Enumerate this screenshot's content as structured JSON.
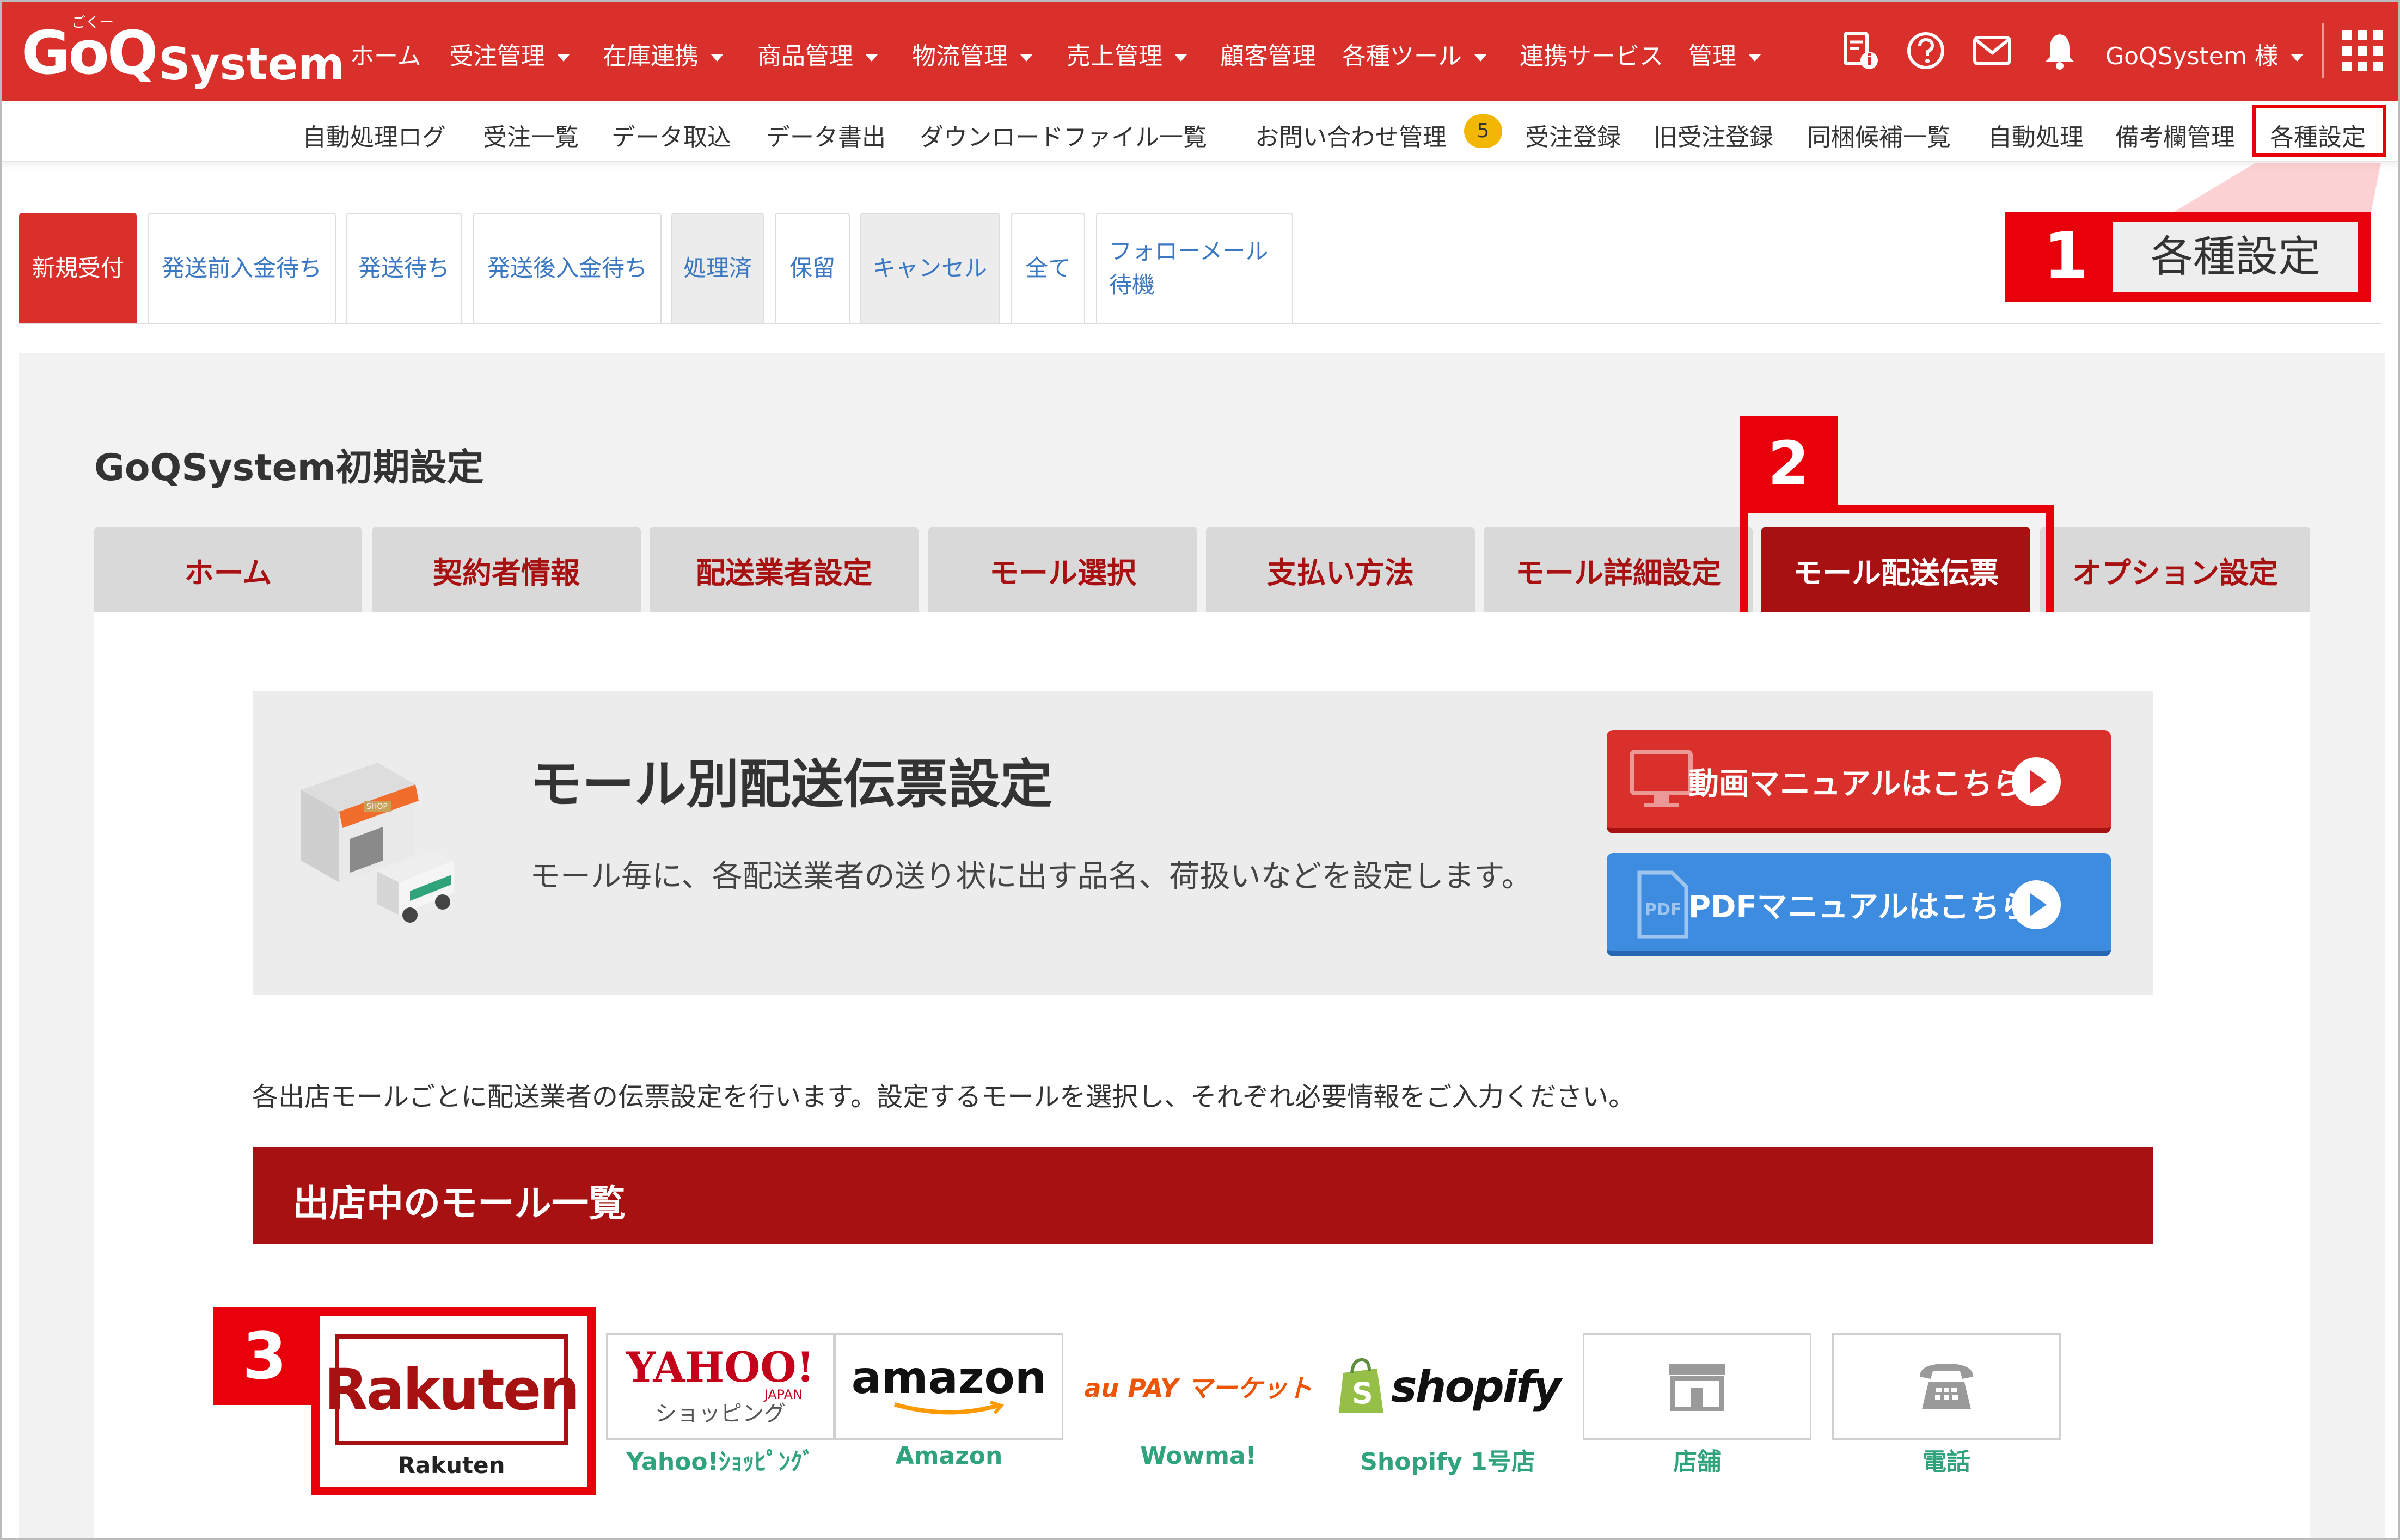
{
  "app": {
    "logo_go": "GoQ",
    "logo_system": "System",
    "logo_kana": "ごくー"
  },
  "topnav": {
    "items": [
      "ホーム",
      "受注管理",
      "在庫連携",
      "商品管理",
      "物流管理",
      "売上管理",
      "顧客管理",
      "各種ツール",
      "連携サービス",
      "管理"
    ],
    "user": "GoQSystem 様"
  },
  "subnav": {
    "items": [
      "自動処理ログ",
      "受注一覧",
      "データ取込",
      "データ書出",
      "ダウンロードファイル一覧",
      "お問い合わせ管理",
      "受注登録",
      "旧受注登録",
      "同梱候補一覧",
      "自動処理",
      "備考欄管理",
      "各種設定"
    ],
    "inquiry_badge": "5"
  },
  "status_tabs": [
    "新規受付",
    "発送前入金待ち",
    "発送待ち",
    "発送後入金待ち",
    "処理済",
    "保留",
    "キャンセル",
    "全て",
    "フォローメール",
    "待機"
  ],
  "callouts": {
    "one": "1",
    "one_label": "各種設定",
    "two": "2",
    "three": "3"
  },
  "page": {
    "title": "GoQSystem初期設定",
    "tabs": [
      "ホーム",
      "契約者情報",
      "配送業者設定",
      "モール選択",
      "支払い方法",
      "モール詳細設定",
      "モール配送伝票",
      "オプション設定"
    ]
  },
  "hero": {
    "title": "モール別配送伝票設定",
    "desc": "モール毎に、各配送業者の送り状に出す品名、荷扱いなどを設定します。",
    "video_btn": "動画マニュアルはこちら",
    "pdf_btn": "PDFマニュアルはこちら",
    "pdf_icon_text": "PDF",
    "shop_sign": "SHOP"
  },
  "intro": "各出店モールごとに配送業者の伝票設定を行います。設定するモールを選択し、それぞれ必要情報をご入力ください。",
  "mall_list": {
    "header": "出店中のモール一覧",
    "malls": [
      {
        "logo": "Rakuten",
        "caption": "Rakuten"
      },
      {
        "logo": "YAHOO!",
        "logo_sub": "JAPAN",
        "logo_sub2": "ショッピング",
        "caption": "Yahoo!ｼｮｯﾋﾟﾝｸﾞ"
      },
      {
        "logo": "amazon",
        "caption": "Amazon"
      },
      {
        "logo": "au PAY マーケット",
        "caption": "Wowma!"
      },
      {
        "logo": "shopify",
        "caption": "Shopify 1号店"
      },
      {
        "caption": "店舗"
      },
      {
        "caption": "電話"
      }
    ]
  },
  "colors": {
    "brand_red": "#d9302c",
    "dark_red": "#a81112",
    "callout_red": "#e8000b",
    "link_blue": "#3a78c4",
    "mall_green": "#2fa37a"
  }
}
